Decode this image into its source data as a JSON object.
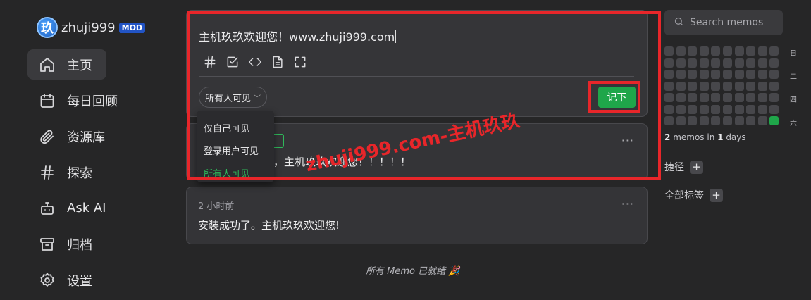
{
  "profile": {
    "avatar_char": "玖",
    "username": "zhuji999",
    "badge": "MOD"
  },
  "nav": [
    {
      "label": "主页",
      "icon": "home-icon",
      "active": true
    },
    {
      "label": "每日回顾",
      "icon": "calendar-icon"
    },
    {
      "label": "资源库",
      "icon": "paperclip-icon"
    },
    {
      "label": "探索",
      "icon": "hash-icon"
    },
    {
      "label": "Ask AI",
      "icon": "robot-icon"
    },
    {
      "label": "归档",
      "icon": "archive-icon"
    },
    {
      "label": "设置",
      "icon": "gear-icon"
    }
  ],
  "editor": {
    "text": "主机玖玖欢迎您！www.zhuji999.com",
    "toolbar": [
      "hash-icon",
      "checkbox-icon",
      "code-icon",
      "document-icon",
      "fullscreen-icon"
    ],
    "visibility_label": "所有人可见",
    "save_label": "记下"
  },
  "visibility_options": [
    {
      "label": "仅自己可见"
    },
    {
      "label": "登录用户可见"
    },
    {
      "label": "所有人可见",
      "selected": true
    }
  ],
  "memos": [
    {
      "time": "",
      "content": "功，主机玖玖欢迎您！！！！！"
    },
    {
      "time": "2 小时前",
      "content": "安装成功了。主机玖玖欢迎您!"
    }
  ],
  "footer_note": "所有 Memo 已就绪 🎉",
  "watermark": "zhuji999.com-主机玖玖",
  "search": {
    "placeholder": "Search memos"
  },
  "heatmap": {
    "rows": 7,
    "cols": 10,
    "active_cells": [
      [
        6,
        9
      ]
    ],
    "active_color": "#1fa64a"
  },
  "weekdays": [
    "日",
    "二",
    "四",
    "六"
  ],
  "stats": {
    "memos": "2",
    "memos_word": "memos in",
    "days": "1",
    "days_word": "days"
  },
  "sections": {
    "shortcuts": "捷径",
    "tags": "全部标签"
  },
  "colors": {
    "accent": "#1fa64a",
    "highlight": "#e8262a"
  }
}
